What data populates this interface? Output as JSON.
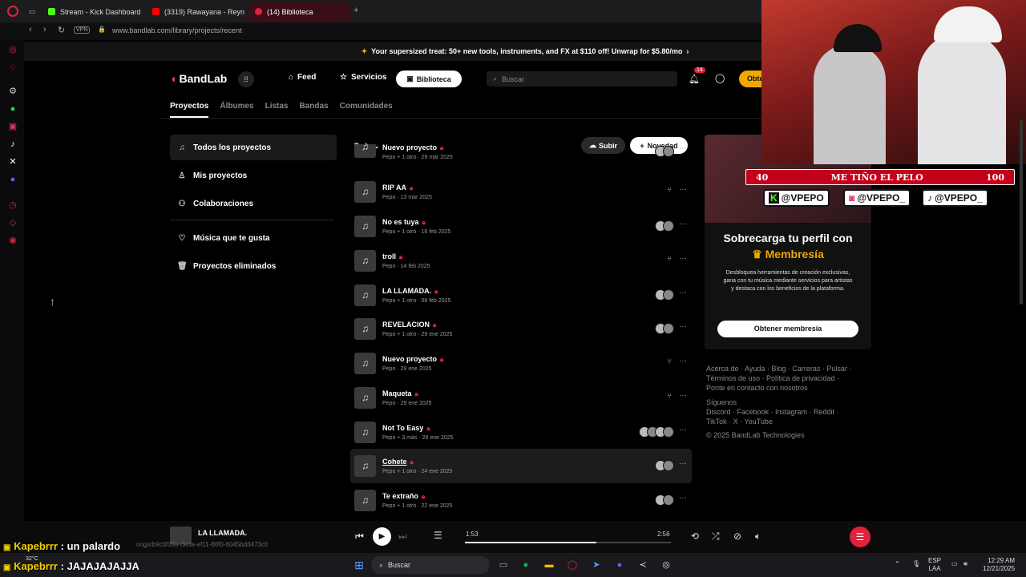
{
  "browser": {
    "tabs": [
      {
        "label": "Stream - Kick Dashboard",
        "color": "#53fc18"
      },
      {
        "label": "(3319) Rawayana - Reyn",
        "color": "#ff0000"
      },
      {
        "label": "(14) Biblioteca",
        "color": "#e0223a"
      }
    ],
    "url": "www.bandlab.com/library/projects/recent",
    "vpn": "VPN"
  },
  "banner": {
    "text": "Your supersized treat: 50+ new tools, instruments, and FX at $110 off! Unwrap for $5.80/mo"
  },
  "header": {
    "logo": "BandLab",
    "feed": "Feed",
    "servicios": "Servicios",
    "biblioteca": "Biblioteca",
    "search_placeholder": "Buscar",
    "notif_count": "14",
    "obtener": "Obte"
  },
  "subtabs": [
    "Proyectos",
    "Álbumes",
    "Listas",
    "Bandas",
    "Comunidades"
  ],
  "leftnav": {
    "todos": "Todos los proyectos",
    "mis": "Mis proyectos",
    "colab": "Colaboraciones",
    "musica": "Música que te gusta",
    "eliminados": "Proyectos eliminados"
  },
  "list": {
    "filter": "Todo",
    "subir": "Subir",
    "novedad": "Novedad",
    "rows": [
      {
        "title": "Nuevo proyecto",
        "owner": "Pepo + 1 otro",
        "date": "29 mar 2025"
      },
      {
        "title": "RIP AA",
        "owner": "Pepo",
        "date": "13 mar 2025"
      },
      {
        "title": "No es tuya",
        "owner": "Pepo + 1 otro",
        "date": "16 feb 2025"
      },
      {
        "title": "troll",
        "owner": "Pepo",
        "date": "14 feb 2025"
      },
      {
        "title": "LA LLAMADA.",
        "owner": "Pepo + 1 otro",
        "date": "08 feb 2025"
      },
      {
        "title": "REVELACION",
        "owner": "Pepo + 1 otro",
        "date": "29 ene 2025"
      },
      {
        "title": "Nuevo proyecto",
        "owner": "Pepo",
        "date": "29 ene 2025"
      },
      {
        "title": "Maqueta",
        "owner": "Pepo",
        "date": "29 ene 2025"
      },
      {
        "title": "Not To Easy",
        "owner": "Pepo + 3 más",
        "date": "29 ene 2025"
      },
      {
        "title": "Cohete",
        "owner": "Pepo + 1 otro",
        "date": "24 ene 2025"
      },
      {
        "title": "Te extraño",
        "owner": "Pepo + 1 otro",
        "date": "22 ene 2025"
      }
    ]
  },
  "promo": {
    "title": "Sobrecarga tu perfil con",
    "subtitle": "Membresía",
    "desc": "Desbloquea herramientas de creación exclusivas, gana con tu música mediante servicios para artistas y destaca con los beneficios de la plataforma.",
    "button": "Obtener membresía"
  },
  "footer": {
    "line1": "Acerca de · Ayuda · Blog · Carreras · Pulsar ·",
    "line2": "Términos de uso · Política de privacidad ·",
    "line3": "Ponte en contacto con nosotros",
    "line4": "Síguenos",
    "line5": "Discord · Facebook · Instagram · Reddit ·",
    "line6": "TikTok · X · YouTube",
    "copyright": "© 2025 BandLab Technologies"
  },
  "overlay": {
    "meter_left": "40",
    "meter_text": "ME TIÑO EL PELO",
    "meter_right": "100",
    "kick": "@VPEPO",
    "instagram": "@VPEPO_",
    "tiktok": "@VPEPO_"
  },
  "player": {
    "title": "LA LLAMADA.",
    "url": "ongs/b9c0f39a-0eda-ef11-88f0-6045bd3473c0",
    "elapsed": "1:53",
    "total": "2:56",
    "progress": 0.64
  },
  "chat": [
    {
      "user": "Kapebrrr",
      "msg": "un palardo"
    },
    {
      "user": "Kapebrrr",
      "msg": "JAJAJAJAJJA"
    }
  ],
  "taskbar": {
    "search": "Buscar",
    "weather": "32°C",
    "lang1": "ESP",
    "lang2": "LAA",
    "time": "12:29 AM",
    "date": "12/21/2025"
  }
}
